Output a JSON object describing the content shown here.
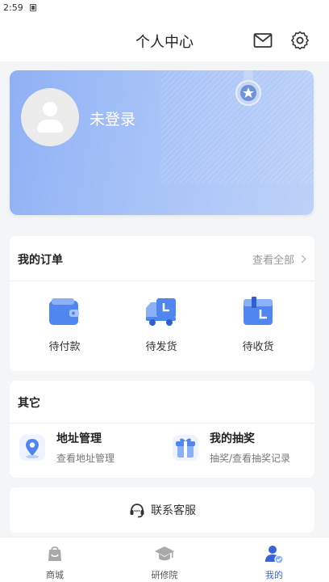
{
  "status_bar": {
    "time": "2:59"
  },
  "header": {
    "title": "个人中心",
    "icons": [
      "mail-icon",
      "gear-icon"
    ]
  },
  "profile": {
    "name": "未登录",
    "icons": [
      "avatar-placeholder-icon",
      "medal-icon"
    ]
  },
  "orders": {
    "title": "我的订单",
    "view_all": "查看全部",
    "items": [
      {
        "label": "待付款",
        "icon": "wallet-icon"
      },
      {
        "label": "待发货",
        "icon": "delivery-truck-icon"
      },
      {
        "label": "待收货",
        "icon": "package-box-icon"
      }
    ]
  },
  "other": {
    "title": "其它",
    "items": [
      {
        "title": "地址管理",
        "subtitle": "查看地址管理",
        "icon": "location-pin-icon"
      },
      {
        "title": "我的抽奖",
        "subtitle": "抽奖/查看抽奖记录",
        "icon": "gift-icon"
      }
    ]
  },
  "service": {
    "label": "联系客服",
    "icon": "headset-icon"
  },
  "tabs": [
    {
      "label": "商城",
      "icon": "shop-bag-icon",
      "active": false
    },
    {
      "label": "研修院",
      "icon": "graduation-cap-icon",
      "active": false
    },
    {
      "label": "我的",
      "icon": "user-profile-icon",
      "active": true
    }
  ],
  "colors": {
    "accent": "#3a63d9",
    "card_gradient_start": "#8fb0f5",
    "card_gradient_end": "#bed2f8",
    "icon_blue": "#4f86f0"
  }
}
